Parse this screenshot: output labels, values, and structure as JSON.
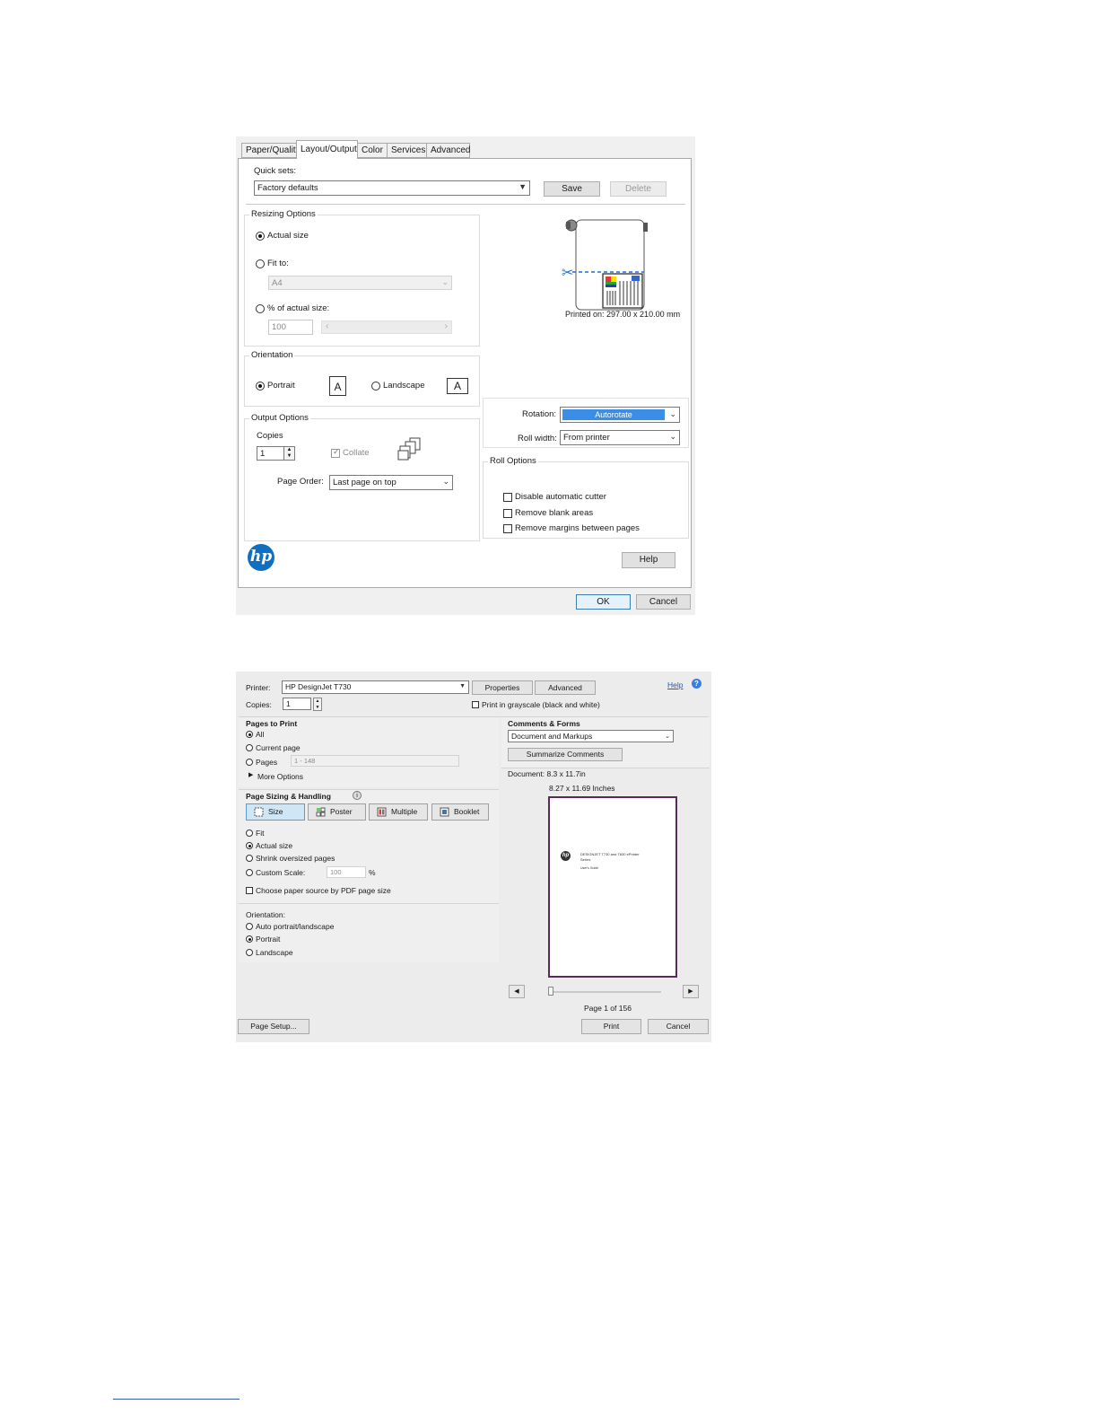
{
  "prefs_dialog": {
    "tabs": [
      "Paper/Quality",
      "Layout/Output",
      "Color",
      "Services",
      "Advanced"
    ],
    "active_tab": "Layout/Output",
    "quick_sets": {
      "label": "Quick sets:",
      "value": "Factory defaults",
      "save_label": "Save",
      "delete_label": "Delete"
    },
    "resizing": {
      "title": "Resizing Options",
      "actual_size_label": "Actual size",
      "fit_to_label": "Fit to:",
      "fit_to_value": "A4",
      "percent_label": "% of actual size:",
      "percent_value": "100",
      "selected": "Actual size"
    },
    "preview": {
      "printed_on": "Printed on: 297.00 x 210.00 mm"
    },
    "orientation": {
      "title": "Orientation",
      "portrait_label": "Portrait",
      "landscape_label": "Landscape",
      "selected": "Portrait",
      "page_glyph": "A"
    },
    "rotation": {
      "label": "Rotation:",
      "value": "Autorotate"
    },
    "roll_width": {
      "label": "Roll width:",
      "value": "From printer"
    },
    "output": {
      "title": "Output Options",
      "copies_label": "Copies",
      "copies_value": "1",
      "collate_label": "Collate",
      "collate_checked": true,
      "page_order_label": "Page Order:",
      "page_order_value": "Last page on top"
    },
    "roll_options": {
      "title": "Roll Options",
      "items": [
        "Disable automatic cutter",
        "Remove blank areas",
        "Remove margins between pages"
      ]
    },
    "logo_text": "hp",
    "help_label": "Help",
    "ok_label": "OK",
    "cancel_label": "Cancel"
  },
  "print_dialog": {
    "printer_label": "Printer:",
    "printer_value": "HP DesignJet T730",
    "properties_label": "Properties",
    "advanced_label": "Advanced",
    "help_link": "Help",
    "copies_label": "Copies:",
    "copies_value": "1",
    "grayscale_label": "Print in grayscale (black and white)",
    "pages_to_print": {
      "title": "Pages to Print",
      "all_label": "All",
      "current_label": "Current page",
      "pages_label": "Pages",
      "pages_value": "1 - 148",
      "more_options_label": "More Options",
      "selected": "All"
    },
    "page_sizing": {
      "title": "Page Sizing & Handling",
      "modes": [
        "Size",
        "Poster",
        "Multiple",
        "Booklet"
      ],
      "selected_mode": "Size",
      "fit_label": "Fit",
      "actual_size_label": "Actual size",
      "shrink_label": "Shrink oversized pages",
      "custom_scale_label": "Custom Scale:",
      "custom_scale_value": "100",
      "custom_scale_unit": "%",
      "paper_source_label": "Choose paper source by PDF page size",
      "selected": "Actual size"
    },
    "orientation": {
      "title": "Orientation:",
      "auto_label": "Auto portrait/landscape",
      "portrait_label": "Portrait",
      "landscape_label": "Landscape",
      "selected": "Portrait"
    },
    "comments_forms": {
      "title": "Comments & Forms",
      "value": "Document and Markups",
      "summarize_label": "Summarize Comments"
    },
    "document_size": "Document: 8.3 x 11.7in",
    "page_size": "8.27 x 11.69 Inches",
    "preview_text": {
      "line1": "DESIGNJET T730 and T830 ePrinter",
      "line2": "Series",
      "line3": "User's Guide"
    },
    "page_counter": "Page 1 of 156",
    "page_setup_label": "Page Setup...",
    "print_label": "Print",
    "cancel_label": "Cancel"
  }
}
